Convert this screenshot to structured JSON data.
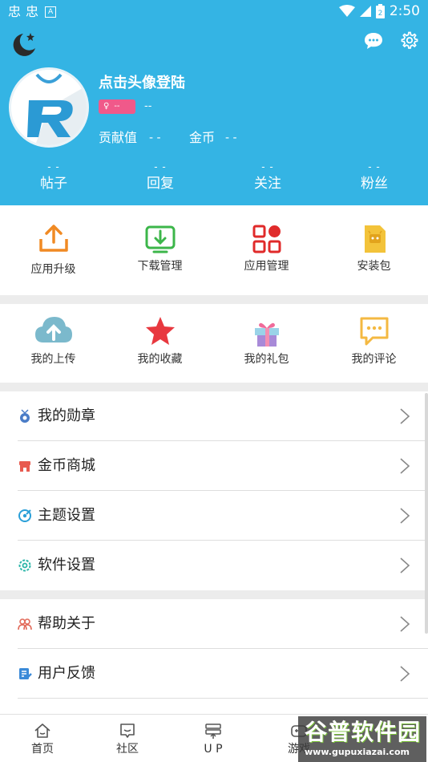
{
  "status_bar": {
    "left_glyphs": [
      "忠",
      "忠"
    ],
    "a_badge": "A",
    "time": "2:50",
    "battery": "2"
  },
  "profile": {
    "login_prompt": "点击头像登陆",
    "level_value": "--",
    "level_text": "--",
    "contribution_label": "贡献值",
    "contribution_value": "- -",
    "coins_label": "金币",
    "coins_value": "- -"
  },
  "stats": [
    {
      "value": "- -",
      "label": "帖子"
    },
    {
      "value": "- -",
      "label": "回复"
    },
    {
      "value": "- -",
      "label": "关注"
    },
    {
      "value": "- -",
      "label": "粉丝"
    }
  ],
  "grid_top": [
    {
      "label": "应用升级",
      "icon": "upload-tray-icon",
      "color": "#f08a24"
    },
    {
      "label": "下载管理",
      "icon": "download-screen-icon",
      "color": "#3cb64a"
    },
    {
      "label": "应用管理",
      "icon": "apps-grid-icon",
      "color": "#e02a2a"
    },
    {
      "label": "安装包",
      "icon": "package-file-icon",
      "color": "#f3c33a"
    }
  ],
  "grid_bottom": [
    {
      "label": "我的上传",
      "icon": "cloud-upload-icon",
      "color": "#7bb9cc"
    },
    {
      "label": "我的收藏",
      "icon": "star-icon",
      "color": "#e8383f"
    },
    {
      "label": "我的礼包",
      "icon": "gift-icon",
      "color": "#a88ad8"
    },
    {
      "label": "我的评论",
      "icon": "comment-bubble-icon",
      "color": "#f4b942"
    }
  ],
  "menu": [
    {
      "label": "我的勋章",
      "icon": "medal-icon",
      "color": "#4a7cc7"
    },
    {
      "label": "金币商城",
      "icon": "shop-icon",
      "color": "#e85a4f"
    },
    {
      "label": "主题设置",
      "icon": "palette-icon",
      "color": "#2a9fd8"
    },
    {
      "label": "软件设置",
      "icon": "settings-icon",
      "color": "#2ab5a8"
    },
    {
      "label": "帮助关于",
      "icon": "help-users-icon",
      "color": "#e26a5a"
    },
    {
      "label": "用户反馈",
      "icon": "feedback-icon",
      "color": "#3a8ad8"
    }
  ],
  "bottom_nav": [
    {
      "label": "首页",
      "icon": "home-icon"
    },
    {
      "label": "社区",
      "icon": "community-icon"
    },
    {
      "label": "U P",
      "icon": "up-icon"
    },
    {
      "label": "游戏",
      "icon": "game-icon"
    }
  ],
  "watermark": {
    "title": "谷普软件园",
    "url": "www.gupuxiazai.com"
  },
  "colors": {
    "header_bg": "#34b4e4",
    "badge_pink": "#f0598a",
    "divider": "#dedede"
  }
}
